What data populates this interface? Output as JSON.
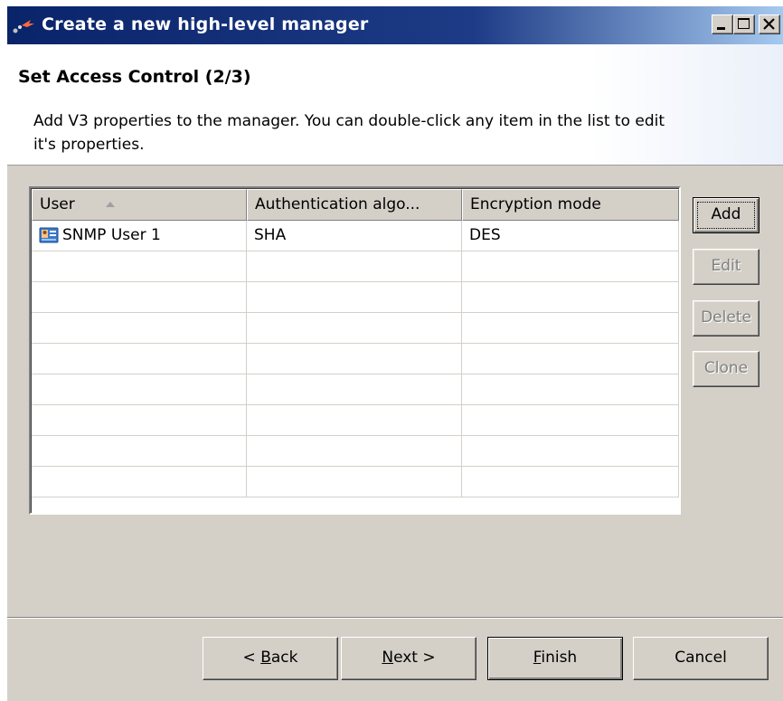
{
  "window": {
    "title": "Create a new high-level manager",
    "icon": "wizard-arrow-icon",
    "controls": [
      "minimize-icon",
      "maximize-icon",
      "close-icon"
    ]
  },
  "header": {
    "heading": "Set Access Control (2/3)",
    "description": "Add V3 properties to the manager. You can double-click any item in the list to edit it's properties."
  },
  "table": {
    "columns": [
      "User",
      "Authentication algo...",
      "Encryption mode"
    ],
    "sort_column": "User",
    "sort_direction": "ascending",
    "rows": [
      {
        "user": "SNMP User 1",
        "auth": "SHA",
        "encryption": "DES",
        "icon": "user-card-icon"
      }
    ],
    "empty_rows": 8
  },
  "side_buttons": {
    "add": "Add",
    "edit": "Edit",
    "delete": "Delete",
    "clone": "Clone"
  },
  "footer": {
    "back": {
      "prefix": "< ",
      "mnemonic": "B",
      "rest": "ack"
    },
    "next": {
      "mnemonic": "N",
      "rest": "ext >"
    },
    "finish": {
      "mnemonic": "F",
      "rest": "inish"
    },
    "cancel": "Cancel"
  },
  "colors": {
    "titlebar_start": "#0a246a",
    "titlebar_end": "#a6caf0",
    "dialog_bg": "#d4d0c8",
    "disabled_text": "#808080"
  }
}
